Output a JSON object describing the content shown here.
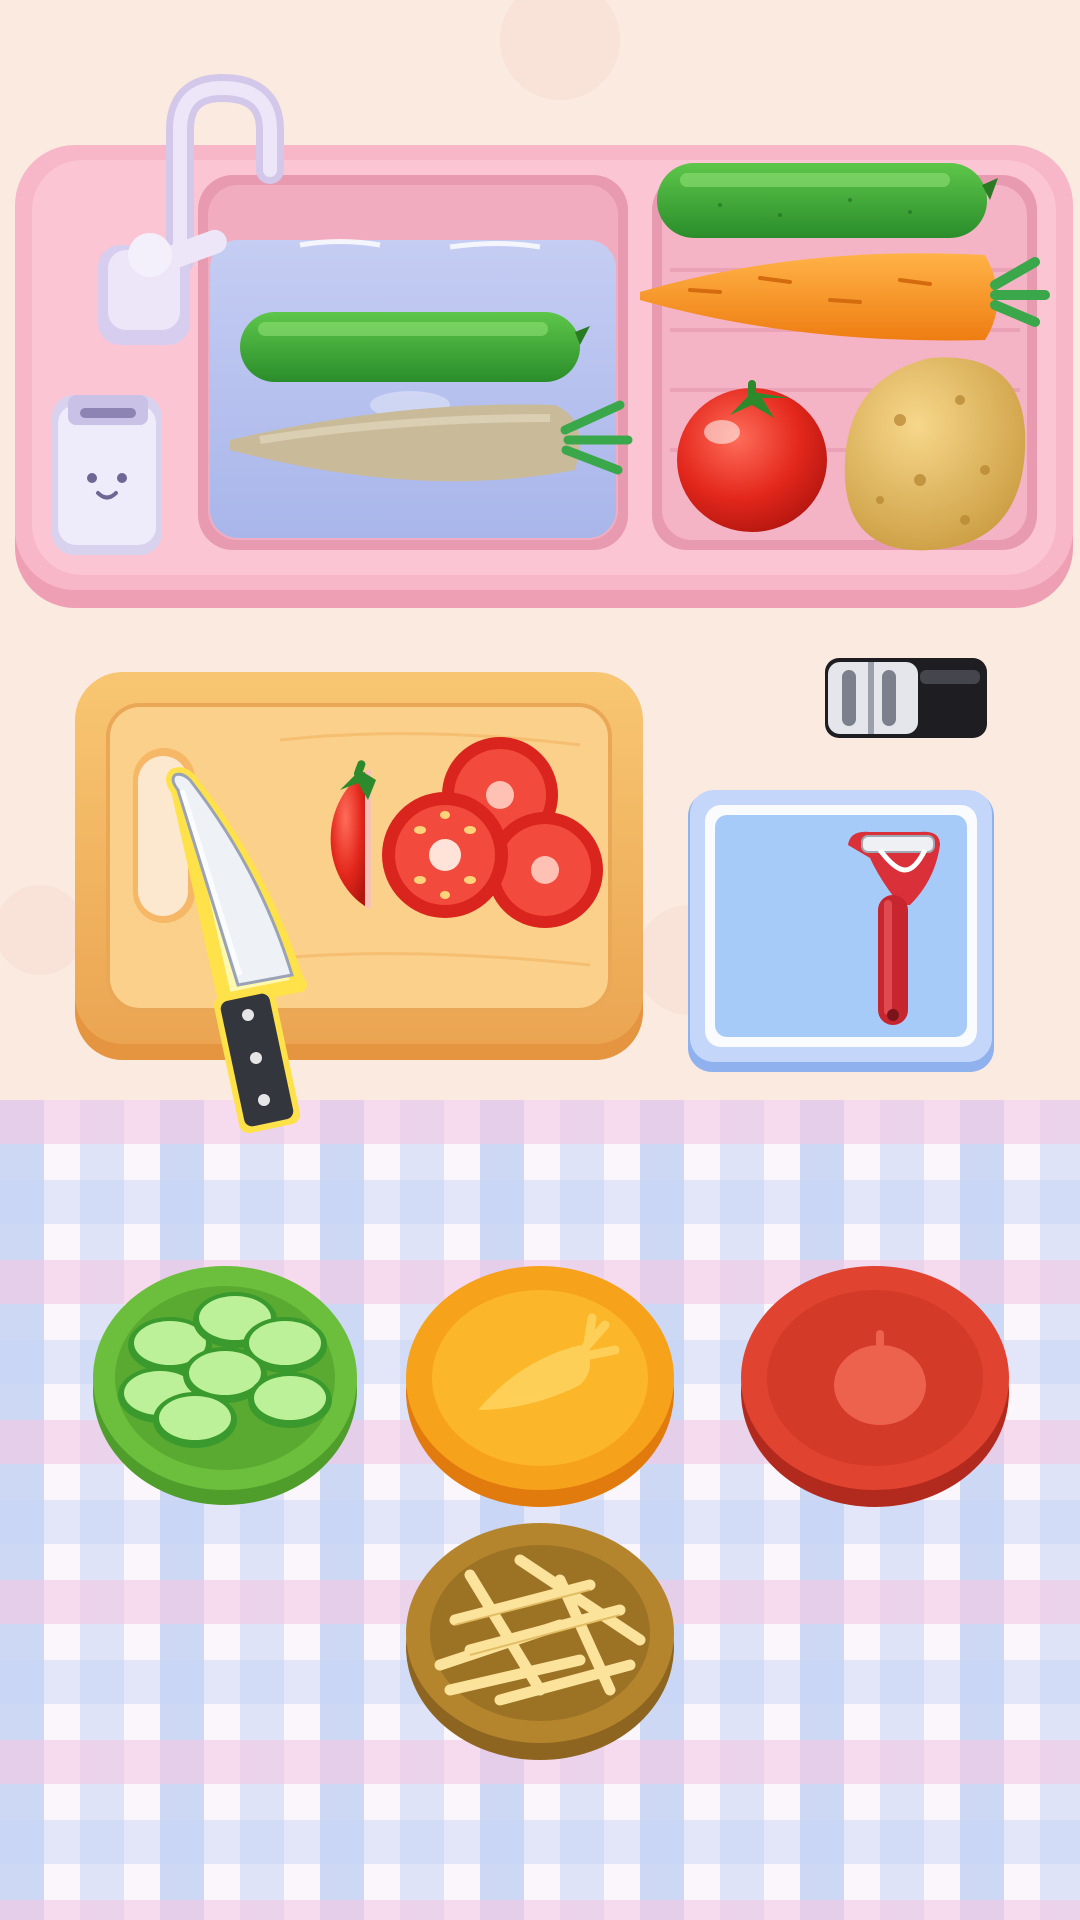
{
  "scene": {
    "type": "vegetable-prep-cooking-game",
    "counter_color": "#fbeadf",
    "tablecloth_colors": [
      "#ffffff",
      "#c9d6f6",
      "#f7cfe6"
    ]
  },
  "sink": {
    "icon": "sink-icon",
    "faucet_icon": "faucet-icon",
    "soap_dispenser_icon": "soap-dispenser-icon",
    "water_basin": {
      "items": [
        {
          "name": "cucumber",
          "icon": "cucumber-icon",
          "state": "in-water"
        },
        {
          "name": "carrot",
          "icon": "carrot-icon",
          "state": "peeled-in-water"
        }
      ]
    },
    "drying_rack": {
      "items": [
        {
          "name": "cucumber",
          "icon": "cucumber-icon"
        },
        {
          "name": "carrot",
          "icon": "carrot-icon"
        },
        {
          "name": "tomato",
          "icon": "tomato-icon"
        },
        {
          "name": "potato",
          "icon": "potato-icon"
        }
      ]
    }
  },
  "tools": {
    "cutting_board": {
      "icon": "cutting-board-icon",
      "item": "tomato",
      "state": "sliced"
    },
    "knife": {
      "icon": "knife-icon",
      "highlighted": true
    },
    "knife_sharpener": {
      "icon": "knife-sharpener-icon"
    },
    "peeler_tray": {
      "icon": "peeler-icon",
      "color": "#d9303a"
    }
  },
  "plates": [
    {
      "name": "cucumber-plate",
      "color": "#6cbf3c",
      "contents": "cucumber-slices",
      "icon": "cucumber-slices-icon"
    },
    {
      "name": "carrot-plate",
      "color": "#f7a21b",
      "contents": "empty",
      "icon": "carrot-icon"
    },
    {
      "name": "tomato-plate",
      "color": "#e0432f",
      "contents": "empty",
      "icon": "tomato-icon"
    },
    {
      "name": "potato-plate",
      "color": "#b4852c",
      "contents": "potato-sticks",
      "icon": "potato-sticks-icon"
    }
  ]
}
